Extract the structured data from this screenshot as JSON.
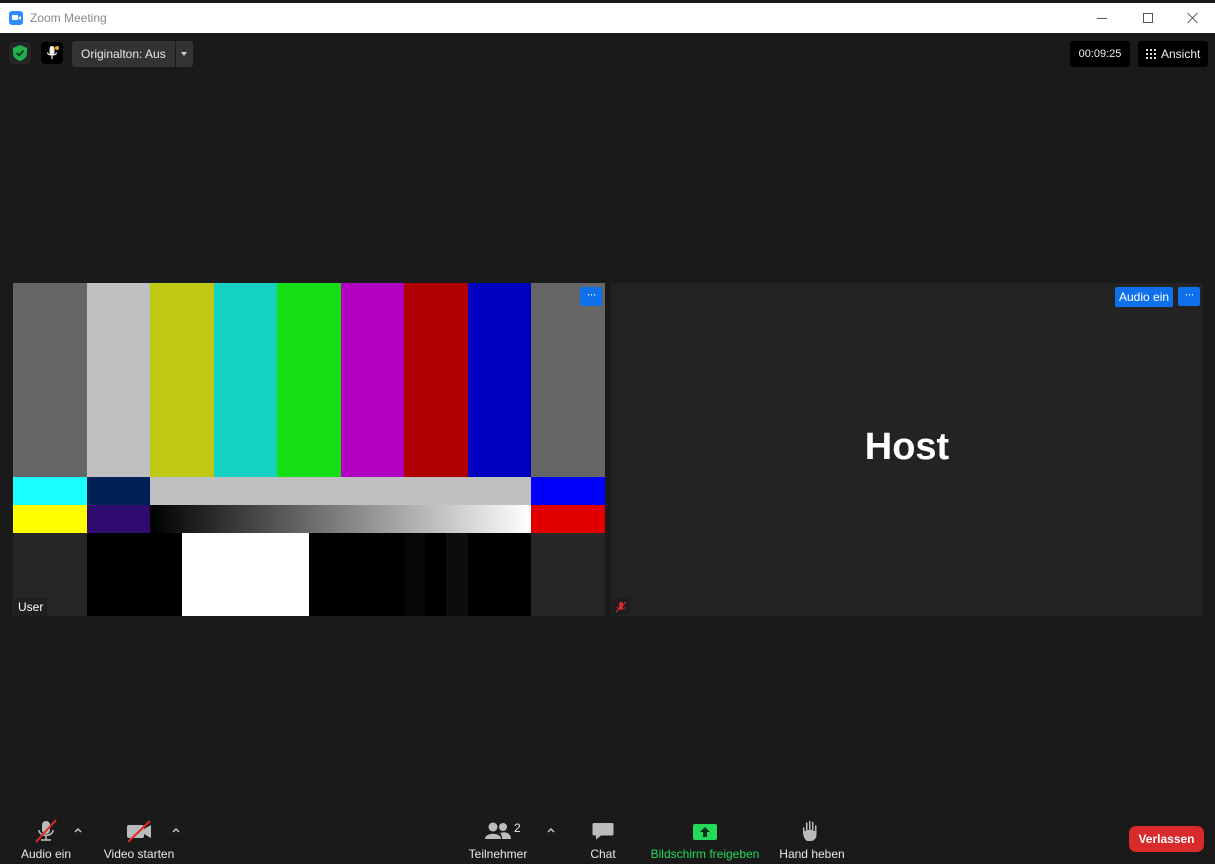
{
  "window": {
    "title": "Zoom Meeting"
  },
  "topbar": {
    "original_sound_label": "Originalton: Aus",
    "timer": "00:09:25",
    "view_label": "Ansicht"
  },
  "tiles": {
    "user": {
      "name": "User",
      "more_label": "···"
    },
    "host": {
      "name": "Host",
      "audio_button_label": "Audio ein",
      "more_label": "···"
    }
  },
  "toolbar": {
    "audio_label": "Audio ein",
    "video_label": "Video starten",
    "participants_label": "Teilnehmer",
    "participants_count": "2",
    "chat_label": "Chat",
    "share_label": "Bildschirm freigeben",
    "hand_label": "Hand heben",
    "leave_label": "Verlassen"
  },
  "colors": {
    "accent_blue": "#0e71eb",
    "share_green": "#23d959",
    "leave_red": "#d92b2b",
    "shield_green": "#22b14c"
  },
  "test_pattern": {
    "top_bars": [
      "#666666",
      "#c0c0c0",
      "#c0c912",
      "#14d3c3",
      "#14df14",
      "#b100c0",
      "#b00000",
      "#0000c0",
      "#666666"
    ],
    "mid_left": [
      "#1affff",
      "#002155"
    ],
    "mid_center": "#c0c0c0",
    "mid_right": "#0000ff",
    "low_left": [
      "#ffff00",
      "#300b6f"
    ],
    "low_right": "#e00000",
    "bottom_white": "#ffffff",
    "bottom_side": "#262626"
  }
}
